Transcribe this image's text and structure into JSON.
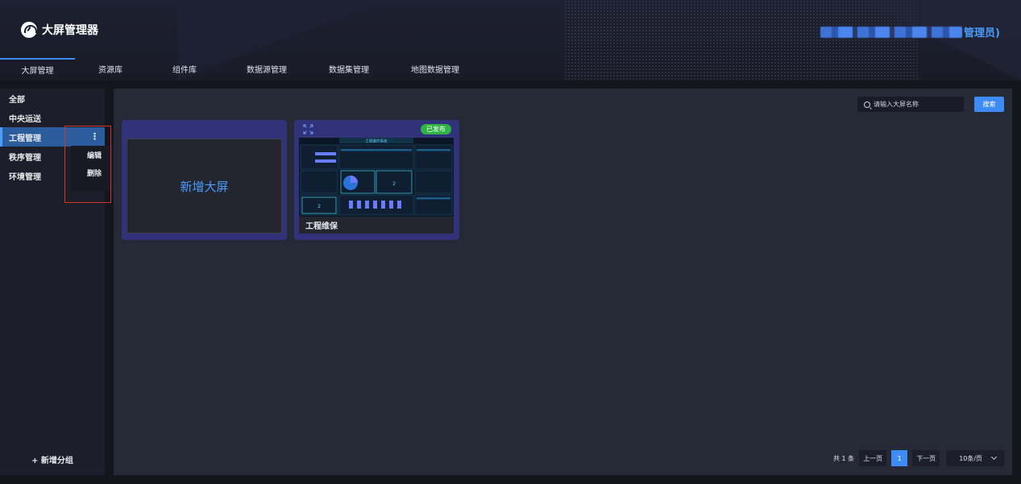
{
  "header": {
    "app_title": "大屏管理器",
    "admin_suffix": "管理员)"
  },
  "nav": {
    "tabs": [
      {
        "label": "大屏管理",
        "active": true
      },
      {
        "label": "资源库"
      },
      {
        "label": "组件库"
      },
      {
        "label": "数据源管理"
      },
      {
        "label": "数据集管理"
      },
      {
        "label": "地图数据管理"
      }
    ]
  },
  "sidebar": {
    "items": [
      {
        "label": "全部"
      },
      {
        "label": "中央运送"
      },
      {
        "label": "工程管理",
        "active": true
      },
      {
        "label": "秩序管理"
      },
      {
        "label": "环境管理"
      }
    ],
    "add_group": "+ 新增分组",
    "more_icon": "⋮"
  },
  "context_menu": {
    "items": [
      {
        "label": "编辑"
      },
      {
        "label": "删除"
      }
    ]
  },
  "search": {
    "placeholder": "请输入大屏名称",
    "button": "搜索"
  },
  "cards": {
    "new_label": "新增大屏",
    "project": {
      "title": "工程维保",
      "status": "已发布",
      "thumbnail_title": "工程维护系统"
    }
  },
  "pagination": {
    "total": "共 1 条",
    "prev": "上一页",
    "current": "1",
    "next": "下一页",
    "page_size": "10条/页"
  },
  "colors": {
    "accent": "#3d8cf5",
    "published": "#2fb344",
    "card_bg": "#313279",
    "highlight": "#d8312e"
  }
}
